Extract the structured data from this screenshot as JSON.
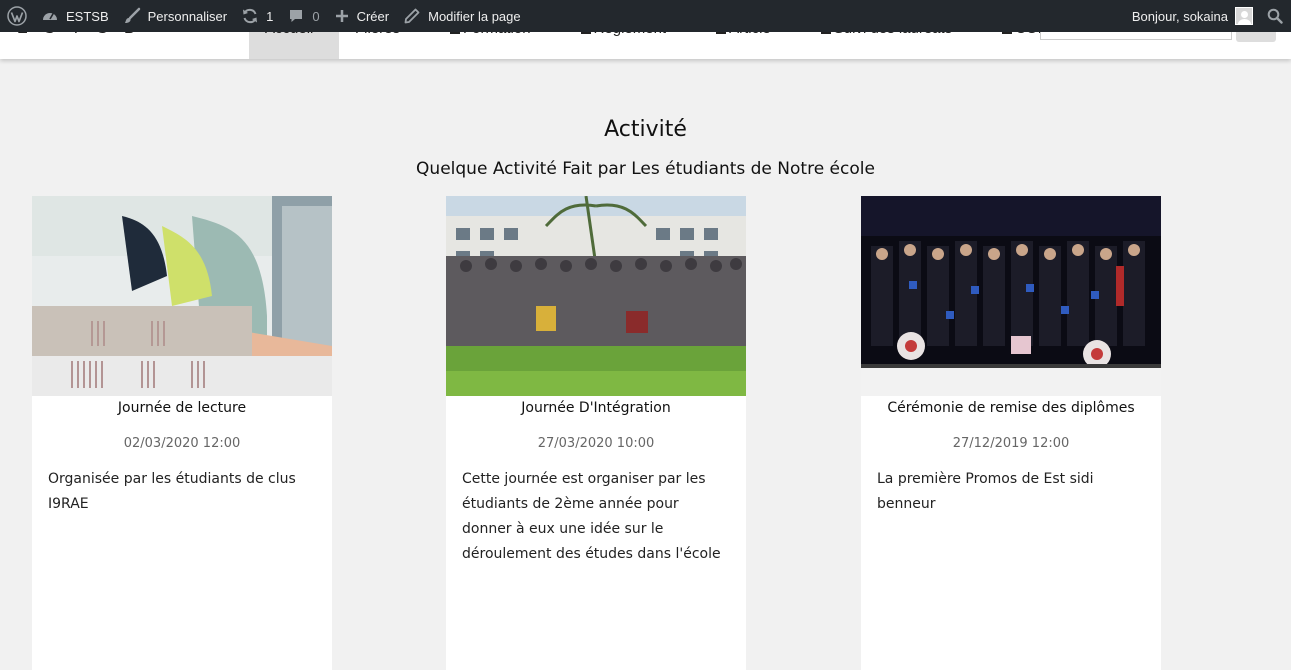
{
  "adminbar": {
    "site_name": "ESTSB",
    "customize": "Personnaliser",
    "updates_count": "1",
    "comments_count": "0",
    "new_label": "Créer",
    "edit_label": "Modifier la page",
    "greeting": "Bonjour, sokaina"
  },
  "nav": {
    "brand": "E S T S B",
    "items": [
      "Accueil",
      "Filères",
      "Formation",
      "Reglement",
      "Article",
      "Suivi des lauréats",
      "CONTACT"
    ]
  },
  "section": {
    "title": "Activité",
    "subtitle": "Quelque Activité Fait par Les étudiants de Notre école"
  },
  "cards": [
    {
      "title": "Journée de lecture",
      "date": "02/03/2020 12:00",
      "desc": "Organisée par les étudiants de clus I9RAE",
      "image": "students-reading-image"
    },
    {
      "title": "Journée D'Intégration",
      "date": "27/03/2020 10:00",
      "desc": "Cette journée est organiser par les étudiants de 2ème année pour donner à eux une idée sur le déroulement des études dans l'école",
      "image": "group-photo-image"
    },
    {
      "title": "Cérémonie de remise des diplômes",
      "date": "27/12/2019 12:00",
      "desc": "La première Promos de Est sidi benneur",
      "image": "graduation-ceremony-image"
    }
  ],
  "colors": {
    "adminbar_bg": "#23282d",
    "page_bg": "#f1f1f1",
    "nav_active_bg": "#dddddd"
  }
}
